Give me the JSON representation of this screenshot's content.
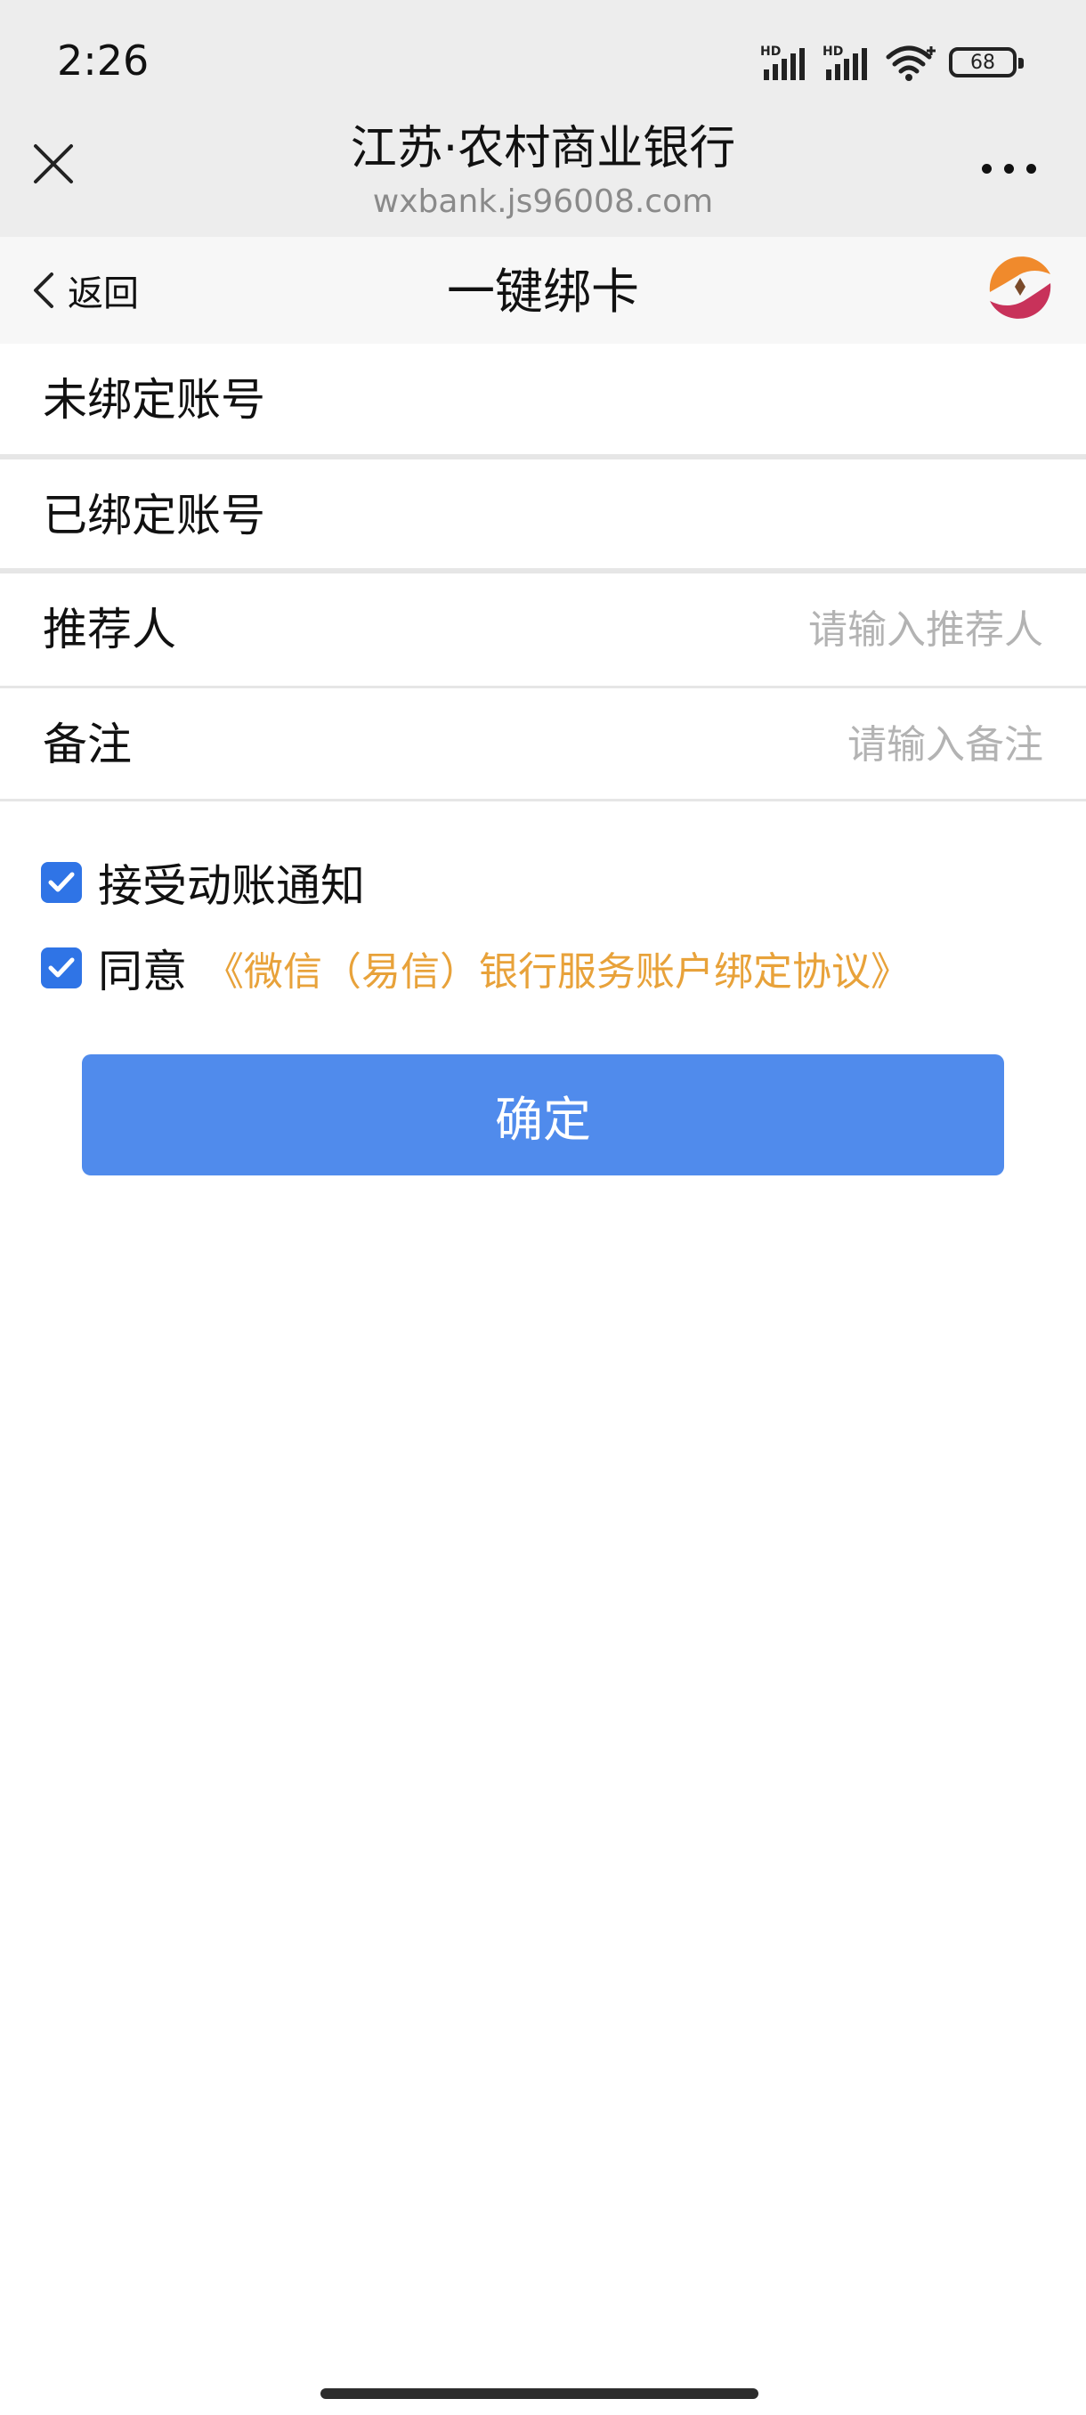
{
  "status_bar": {
    "time": "2:26",
    "battery": "68",
    "icons": [
      "hd-signal-icon",
      "hd-signal-icon",
      "wifi-icon",
      "battery-icon"
    ]
  },
  "browser": {
    "title": "江苏·农村商业银行",
    "url": "wxbank.js96008.com",
    "close_icon": "close-icon",
    "more_icon": "more-icon"
  },
  "subnav": {
    "back_label": "返回",
    "title": "一键绑卡",
    "logo_icon": "bank-logo"
  },
  "form": {
    "unbound_label": "未绑定账号",
    "bound_label": "已绑定账号",
    "referrer_label": "推荐人",
    "referrer_placeholder": "请输入推荐人",
    "remark_label": "备注",
    "remark_placeholder": "请输入备注"
  },
  "options": {
    "notify_label": "接受动账通知",
    "notify_checked": true,
    "agree_label": "同意",
    "agree_checked": true,
    "agreement_link": "《微信（易信）银行服务账户绑定协议》"
  },
  "confirm_label": "确定",
  "colors": {
    "accent": "#508bec",
    "checkbox": "#2f74e6",
    "link": "#e8a23a",
    "placeholder": "#b3b3b3"
  }
}
